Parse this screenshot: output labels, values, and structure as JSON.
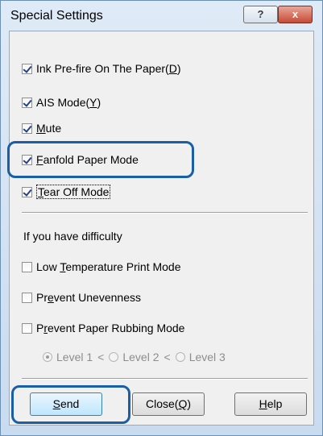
{
  "window": {
    "title": "Special Settings",
    "help_button": "?",
    "close_button": "x"
  },
  "options": [
    {
      "pre": "Ink Pre-fire On The Paper(",
      "key": "D",
      "post": ")",
      "checked": true
    },
    {
      "pre": "AIS Mode(",
      "key": "Y",
      "post": ")",
      "checked": true
    },
    {
      "pre": "",
      "key": "M",
      "post": "ute",
      "checked": true
    },
    {
      "pre": "",
      "key": "F",
      "post": "anfold Paper Mode",
      "checked": true
    },
    {
      "pre": "",
      "key": "T",
      "post": "ear Off Mode",
      "checked": true
    }
  ],
  "difficulty_heading": "If you have difficulty",
  "difficulty_options": [
    {
      "pre": "Low ",
      "key": "T",
      "post": "emperature Print Mode",
      "checked": false
    },
    {
      "pre": "Pr",
      "key": "e",
      "post": "vent Unevenness",
      "checked": false
    },
    {
      "pre": "P",
      "key": "r",
      "post": "event Paper Rubbing Mode",
      "checked": false
    }
  ],
  "levels": {
    "items": [
      "Level 1",
      "Level 2",
      "Level 3"
    ],
    "separator": "<",
    "selected": "Level 1"
  },
  "buttons": {
    "send": {
      "key": "S",
      "post": "end"
    },
    "close": {
      "pre": "Close(",
      "key": "Q",
      "post": ")"
    },
    "help": {
      "key": "H",
      "post": "elp"
    }
  },
  "highlight_color": "#1a5ea8"
}
